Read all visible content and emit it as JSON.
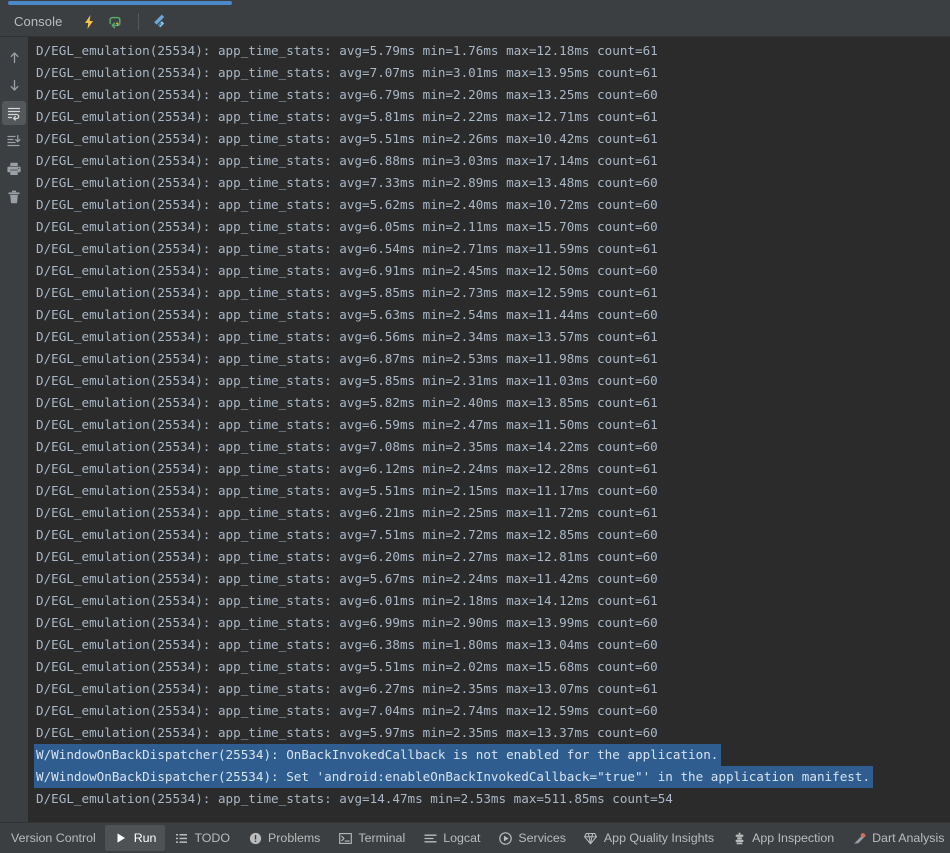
{
  "window": {
    "accent_color": "#4a88c7",
    "header_bg": "#3c3f41",
    "console_bg": "#2b2b2b",
    "selection_color": "#2f5d8f",
    "text_color": "#a9b7c6"
  },
  "header": {
    "tab_label": "Console",
    "icons": [
      {
        "name": "lightning-icon",
        "title": "Flutter Performance",
        "color": "#f5c542"
      },
      {
        "name": "hot-reload-icon",
        "title": "Hot Reload",
        "color": "#59a869"
      },
      {
        "name": "flutter-icon",
        "title": "Open Flutter DevTools",
        "color": "#5a9fd4"
      }
    ]
  },
  "gutter": {
    "buttons": [
      {
        "name": "up-arrow-icon",
        "title": "Up the Stack Trace"
      },
      {
        "name": "down-arrow-icon",
        "title": "Down the Stack Trace"
      },
      {
        "name": "soft-wrap-icon",
        "title": "Soft-Wrap",
        "active": true
      },
      {
        "name": "scroll-to-end-icon",
        "title": "Scroll to End",
        "active": false
      },
      {
        "name": "print-icon",
        "title": "Print",
        "active": false
      },
      {
        "name": "trash-icon",
        "title": "Clear All",
        "active": false
      }
    ]
  },
  "console": {
    "lines": [
      {
        "text": "D/EGL_emulation(25534): app_time_stats: avg=5.79ms min=1.76ms max=12.18ms count=61",
        "level": "debug",
        "selected": false
      },
      {
        "text": "D/EGL_emulation(25534): app_time_stats: avg=7.07ms min=3.01ms max=13.95ms count=61",
        "level": "debug",
        "selected": false
      },
      {
        "text": "D/EGL_emulation(25534): app_time_stats: avg=6.79ms min=2.20ms max=13.25ms count=60",
        "level": "debug",
        "selected": false
      },
      {
        "text": "D/EGL_emulation(25534): app_time_stats: avg=5.81ms min=2.22ms max=12.71ms count=61",
        "level": "debug",
        "selected": false
      },
      {
        "text": "D/EGL_emulation(25534): app_time_stats: avg=5.51ms min=2.26ms max=10.42ms count=61",
        "level": "debug",
        "selected": false
      },
      {
        "text": "D/EGL_emulation(25534): app_time_stats: avg=6.88ms min=3.03ms max=17.14ms count=61",
        "level": "debug",
        "selected": false
      },
      {
        "text": "D/EGL_emulation(25534): app_time_stats: avg=7.33ms min=2.89ms max=13.48ms count=60",
        "level": "debug",
        "selected": false
      },
      {
        "text": "D/EGL_emulation(25534): app_time_stats: avg=5.62ms min=2.40ms max=10.72ms count=60",
        "level": "debug",
        "selected": false
      },
      {
        "text": "D/EGL_emulation(25534): app_time_stats: avg=6.05ms min=2.11ms max=15.70ms count=60",
        "level": "debug",
        "selected": false
      },
      {
        "text": "D/EGL_emulation(25534): app_time_stats: avg=6.54ms min=2.71ms max=11.59ms count=61",
        "level": "debug",
        "selected": false
      },
      {
        "text": "D/EGL_emulation(25534): app_time_stats: avg=6.91ms min=2.45ms max=12.50ms count=60",
        "level": "debug",
        "selected": false
      },
      {
        "text": "D/EGL_emulation(25534): app_time_stats: avg=5.85ms min=2.73ms max=12.59ms count=61",
        "level": "debug",
        "selected": false
      },
      {
        "text": "D/EGL_emulation(25534): app_time_stats: avg=5.63ms min=2.54ms max=11.44ms count=60",
        "level": "debug",
        "selected": false
      },
      {
        "text": "D/EGL_emulation(25534): app_time_stats: avg=6.56ms min=2.34ms max=13.57ms count=61",
        "level": "debug",
        "selected": false
      },
      {
        "text": "D/EGL_emulation(25534): app_time_stats: avg=6.87ms min=2.53ms max=11.98ms count=61",
        "level": "debug",
        "selected": false
      },
      {
        "text": "D/EGL_emulation(25534): app_time_stats: avg=5.85ms min=2.31ms max=11.03ms count=60",
        "level": "debug",
        "selected": false
      },
      {
        "text": "D/EGL_emulation(25534): app_time_stats: avg=5.82ms min=2.40ms max=13.85ms count=61",
        "level": "debug",
        "selected": false
      },
      {
        "text": "D/EGL_emulation(25534): app_time_stats: avg=6.59ms min=2.47ms max=11.50ms count=61",
        "level": "debug",
        "selected": false
      },
      {
        "text": "D/EGL_emulation(25534): app_time_stats: avg=7.08ms min=2.35ms max=14.22ms count=60",
        "level": "debug",
        "selected": false
      },
      {
        "text": "D/EGL_emulation(25534): app_time_stats: avg=6.12ms min=2.24ms max=12.28ms count=61",
        "level": "debug",
        "selected": false
      },
      {
        "text": "D/EGL_emulation(25534): app_time_stats: avg=5.51ms min=2.15ms max=11.17ms count=60",
        "level": "debug",
        "selected": false
      },
      {
        "text": "D/EGL_emulation(25534): app_time_stats: avg=6.21ms min=2.25ms max=11.72ms count=61",
        "level": "debug",
        "selected": false
      },
      {
        "text": "D/EGL_emulation(25534): app_time_stats: avg=7.51ms min=2.72ms max=12.85ms count=60",
        "level": "debug",
        "selected": false
      },
      {
        "text": "D/EGL_emulation(25534): app_time_stats: avg=6.20ms min=2.27ms max=12.81ms count=60",
        "level": "debug",
        "selected": false
      },
      {
        "text": "D/EGL_emulation(25534): app_time_stats: avg=5.67ms min=2.24ms max=11.42ms count=60",
        "level": "debug",
        "selected": false
      },
      {
        "text": "D/EGL_emulation(25534): app_time_stats: avg=6.01ms min=2.18ms max=14.12ms count=61",
        "level": "debug",
        "selected": false
      },
      {
        "text": "D/EGL_emulation(25534): app_time_stats: avg=6.99ms min=2.90ms max=13.99ms count=60",
        "level": "debug",
        "selected": false
      },
      {
        "text": "D/EGL_emulation(25534): app_time_stats: avg=6.38ms min=1.80ms max=13.04ms count=60",
        "level": "debug",
        "selected": false
      },
      {
        "text": "D/EGL_emulation(25534): app_time_stats: avg=5.51ms min=2.02ms max=15.68ms count=60",
        "level": "debug",
        "selected": false
      },
      {
        "text": "D/EGL_emulation(25534): app_time_stats: avg=6.27ms min=2.35ms max=13.07ms count=61",
        "level": "debug",
        "selected": false
      },
      {
        "text": "D/EGL_emulation(25534): app_time_stats: avg=7.04ms min=2.74ms max=12.59ms count=60",
        "level": "debug",
        "selected": false
      },
      {
        "text": "D/EGL_emulation(25534): app_time_stats: avg=5.97ms min=2.35ms max=13.37ms count=60",
        "level": "debug",
        "selected": false
      },
      {
        "text": "W/WindowOnBackDispatcher(25534): OnBackInvokedCallback is not enabled for the application.",
        "level": "warn",
        "selected": true
      },
      {
        "text": "W/WindowOnBackDispatcher(25534): Set 'android:enableOnBackInvokedCallback=\"true\"' in the application manifest.",
        "level": "warn",
        "selected": true
      },
      {
        "text": "D/EGL_emulation(25534): app_time_stats: avg=14.47ms min=2.53ms max=511.85ms count=54",
        "level": "debug",
        "selected": false
      }
    ]
  },
  "statusbar": {
    "items": [
      {
        "label": "Version Control",
        "icon": "version-control-icon",
        "active": false
      },
      {
        "label": "Run",
        "icon": "run-play-icon",
        "active": true
      },
      {
        "label": "TODO",
        "icon": "todo-list-icon",
        "active": false
      },
      {
        "label": "Problems",
        "icon": "problems-warning-icon",
        "active": false
      },
      {
        "label": "Terminal",
        "icon": "terminal-icon",
        "active": false
      },
      {
        "label": "Logcat",
        "icon": "logcat-icon",
        "active": false
      },
      {
        "label": "Services",
        "icon": "services-icon",
        "active": false
      },
      {
        "label": "App Quality Insights",
        "icon": "app-quality-insights-icon",
        "active": false
      },
      {
        "label": "App Inspection",
        "icon": "app-inspection-icon",
        "active": false
      },
      {
        "label": "Dart Analysis",
        "icon": "dart-analysis-icon",
        "active": false
      }
    ]
  }
}
